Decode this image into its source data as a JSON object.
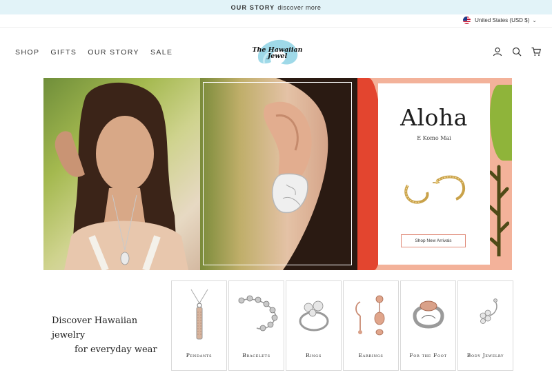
{
  "announcement": {
    "bold": "OUR STORY",
    "text": "discover more"
  },
  "currency": {
    "label": "United States (USD $)"
  },
  "nav": {
    "items": [
      "SHOP",
      "GIFTS",
      "OUR STORY",
      "SALE"
    ]
  },
  "logo": {
    "line1": "The Hawaiian",
    "line2": "Jewel"
  },
  "header_icons": [
    "account-icon",
    "search-icon",
    "cart-icon"
  ],
  "hero": {
    "title": "Aloha",
    "subtitle": "E Komo Mai",
    "cta": "Shop New Arrivals"
  },
  "discover": {
    "line1": "Discover Hawaiian jewelry",
    "line2": "for everyday wear"
  },
  "categories": [
    "Pendants",
    "Bracelets",
    "Rings",
    "Earrings",
    "For the Foot",
    "Body Jewelry"
  ],
  "colors": {
    "announce_bg": "#e2f3f8",
    "accent": "#e08a78",
    "red": "#e3452f",
    "green": "#8fb43a"
  }
}
